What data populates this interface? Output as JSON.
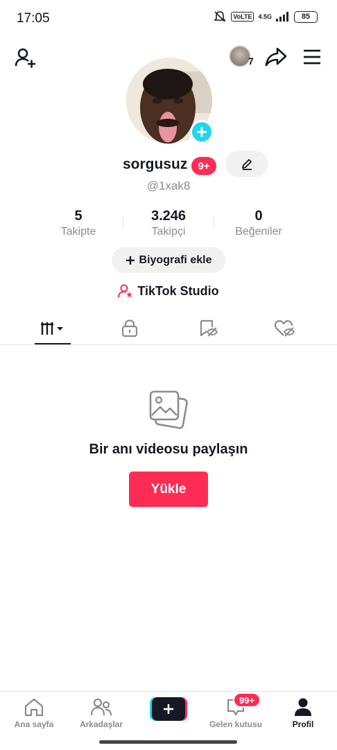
{
  "status_bar": {
    "time": "17:05",
    "network": "4.5G",
    "volte": "VoLTE",
    "battery": "85",
    "icons": [
      "mute-icon",
      "signal-icon",
      "battery-icon"
    ]
  },
  "top_bar": {
    "story_count": "7",
    "icons": [
      "add-user-icon",
      "share-icon",
      "menu-icon"
    ]
  },
  "profile": {
    "username": "sorgusuz",
    "notification_badge": "9+",
    "handle": "@1xak8"
  },
  "stats": [
    {
      "value": "5",
      "label": "Takipte"
    },
    {
      "value": "3.246",
      "label": "Takipçi"
    },
    {
      "value": "0",
      "label": "Beğeniler"
    }
  ],
  "bio_button": {
    "label": "Biyografi ekle"
  },
  "studio_link": {
    "label": "TikTok Studio"
  },
  "tabs": [
    {
      "name": "videos",
      "icon": "grid-icon",
      "active": true
    },
    {
      "name": "private",
      "icon": "lock-icon",
      "active": false
    },
    {
      "name": "saved",
      "icon": "bookmark-hidden-icon",
      "active": false
    },
    {
      "name": "liked",
      "icon": "heart-hidden-icon",
      "active": false
    }
  ],
  "empty_state": {
    "icon": "photos-icon",
    "title": "Bir anı videosu paylaşın",
    "button": "Yükle"
  },
  "bottom_nav": {
    "items": [
      {
        "label": "Ana sayfa",
        "icon": "home-icon",
        "active": false
      },
      {
        "label": "Arkadaşlar",
        "icon": "friends-icon",
        "active": false
      },
      {
        "label": "",
        "icon": "create-icon",
        "active": false
      },
      {
        "label": "Gelen kutusu",
        "icon": "inbox-icon",
        "active": false
      },
      {
        "label": "Profil",
        "icon": "profile-icon",
        "active": true
      }
    ],
    "inbox_badge": "99+"
  },
  "colors": {
    "accent": "#fe2c55",
    "cyan": "#20d5ec",
    "text": "#161823",
    "muted": "#8a8b91"
  }
}
